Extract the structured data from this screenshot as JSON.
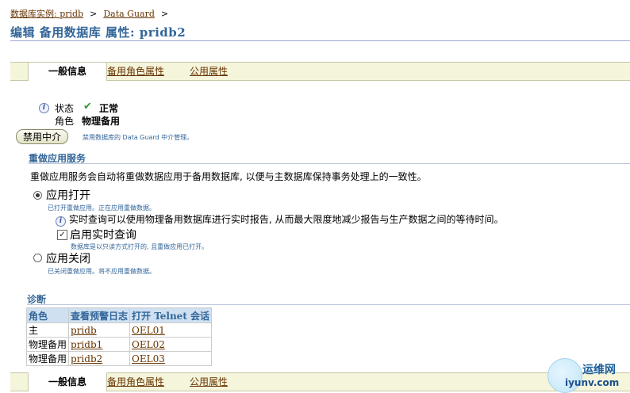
{
  "breadcrumb": {
    "items": [
      "数据库实例: pridb",
      "Data Guard"
    ],
    "separator": ">"
  },
  "page": {
    "title": "编辑  备用数据库  属性: pridb2"
  },
  "tabs": [
    "一般信息",
    "备用角色属性",
    "公用属性"
  ],
  "status": {
    "status_label": "状态",
    "status_value": "正常",
    "role_label": "角色",
    "role_value": "物理备用"
  },
  "mediator": {
    "button_label": "禁用中介",
    "hint": "禁用数据库的 Data Guard 中介管理。"
  },
  "redo_service": {
    "header": "重做应用服务",
    "description": "重做应用服务会自动将重做数据应用于备用数据库, 以便与主数据库保持事务处理上的一致性。",
    "apply_on_label": "应用打开",
    "apply_on_hint": "已打开重做应用。正在应用重做数据。",
    "realtime_info": "实时查询可以使用物理备用数据库进行实时报告, 从而最大限度地减少报告与生产数据之间的等待时间。",
    "realtime_label": "启用实时查询",
    "realtime_hint": "数据库是以只读方式打开的, 且重做应用已打开。",
    "apply_off_label": "应用关闭",
    "apply_off_hint": "已关闭重做应用。将不应用重做数据。"
  },
  "diagnostics": {
    "header": "诊断",
    "columns": [
      "角色",
      "查看预警日志",
      "打开  Telnet 会话"
    ],
    "rows": [
      [
        "主",
        "pridb",
        "OEL01"
      ],
      [
        "物理备用",
        "pridb1",
        "OEL02"
      ],
      [
        "物理备用",
        "pridb2",
        "OEL03"
      ]
    ]
  },
  "watermark": {
    "cn": "运维网",
    "url": "iyunv.com"
  },
  "colors": {
    "accent": "#336699",
    "link": "#663300",
    "tab_bg": "#f5f5dc"
  }
}
